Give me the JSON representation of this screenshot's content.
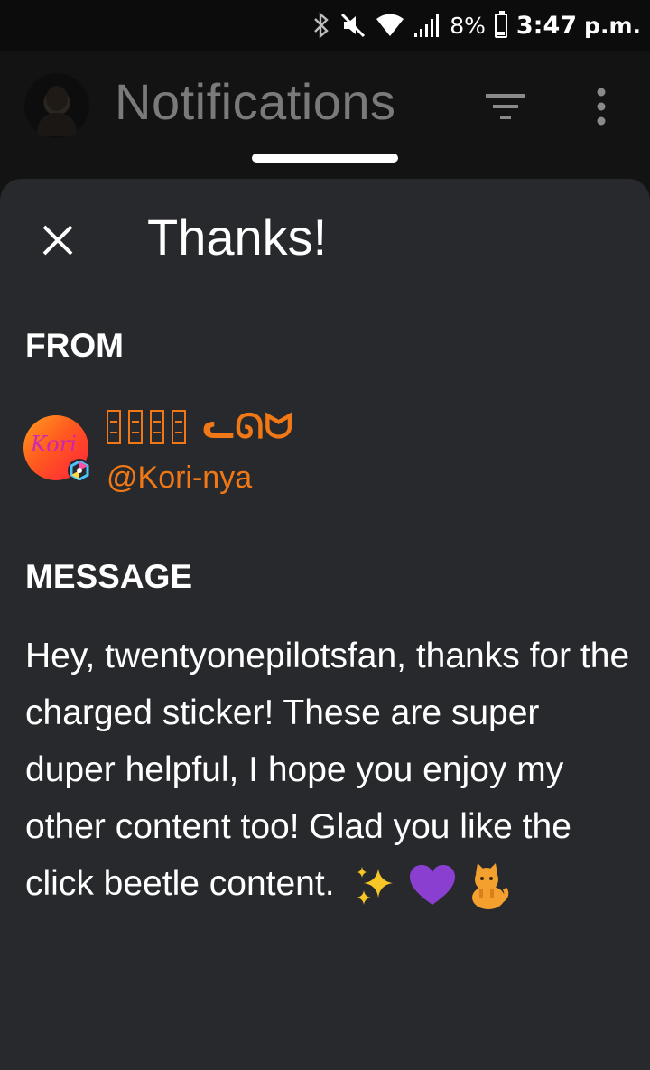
{
  "status_bar": {
    "battery_percent": "8%",
    "time": "3:47",
    "ampm": "p.m."
  },
  "app_bar": {
    "title": "Notifications"
  },
  "sheet": {
    "title": "Thanks!",
    "from_label": "FROM",
    "message_label": "MESSAGE",
    "sender": {
      "display_name_glyphs": "▯▯▯▯",
      "display_name_suffix": "ᓚᘏᗢ",
      "handle": "@Kori-nya",
      "avatar_text": "Kori"
    },
    "message": "Hey, twentyonepilotsfan, thanks for the charged sticker! These are super duper helpful, I hope you enjoy my other content too! Glad you like the click beetle content.",
    "emojis": [
      "sparkles",
      "purple-heart",
      "cat"
    ]
  },
  "colors": {
    "accent_orange": "#f07816",
    "sheet_bg": "#27292c",
    "app_bg": "#131313"
  }
}
